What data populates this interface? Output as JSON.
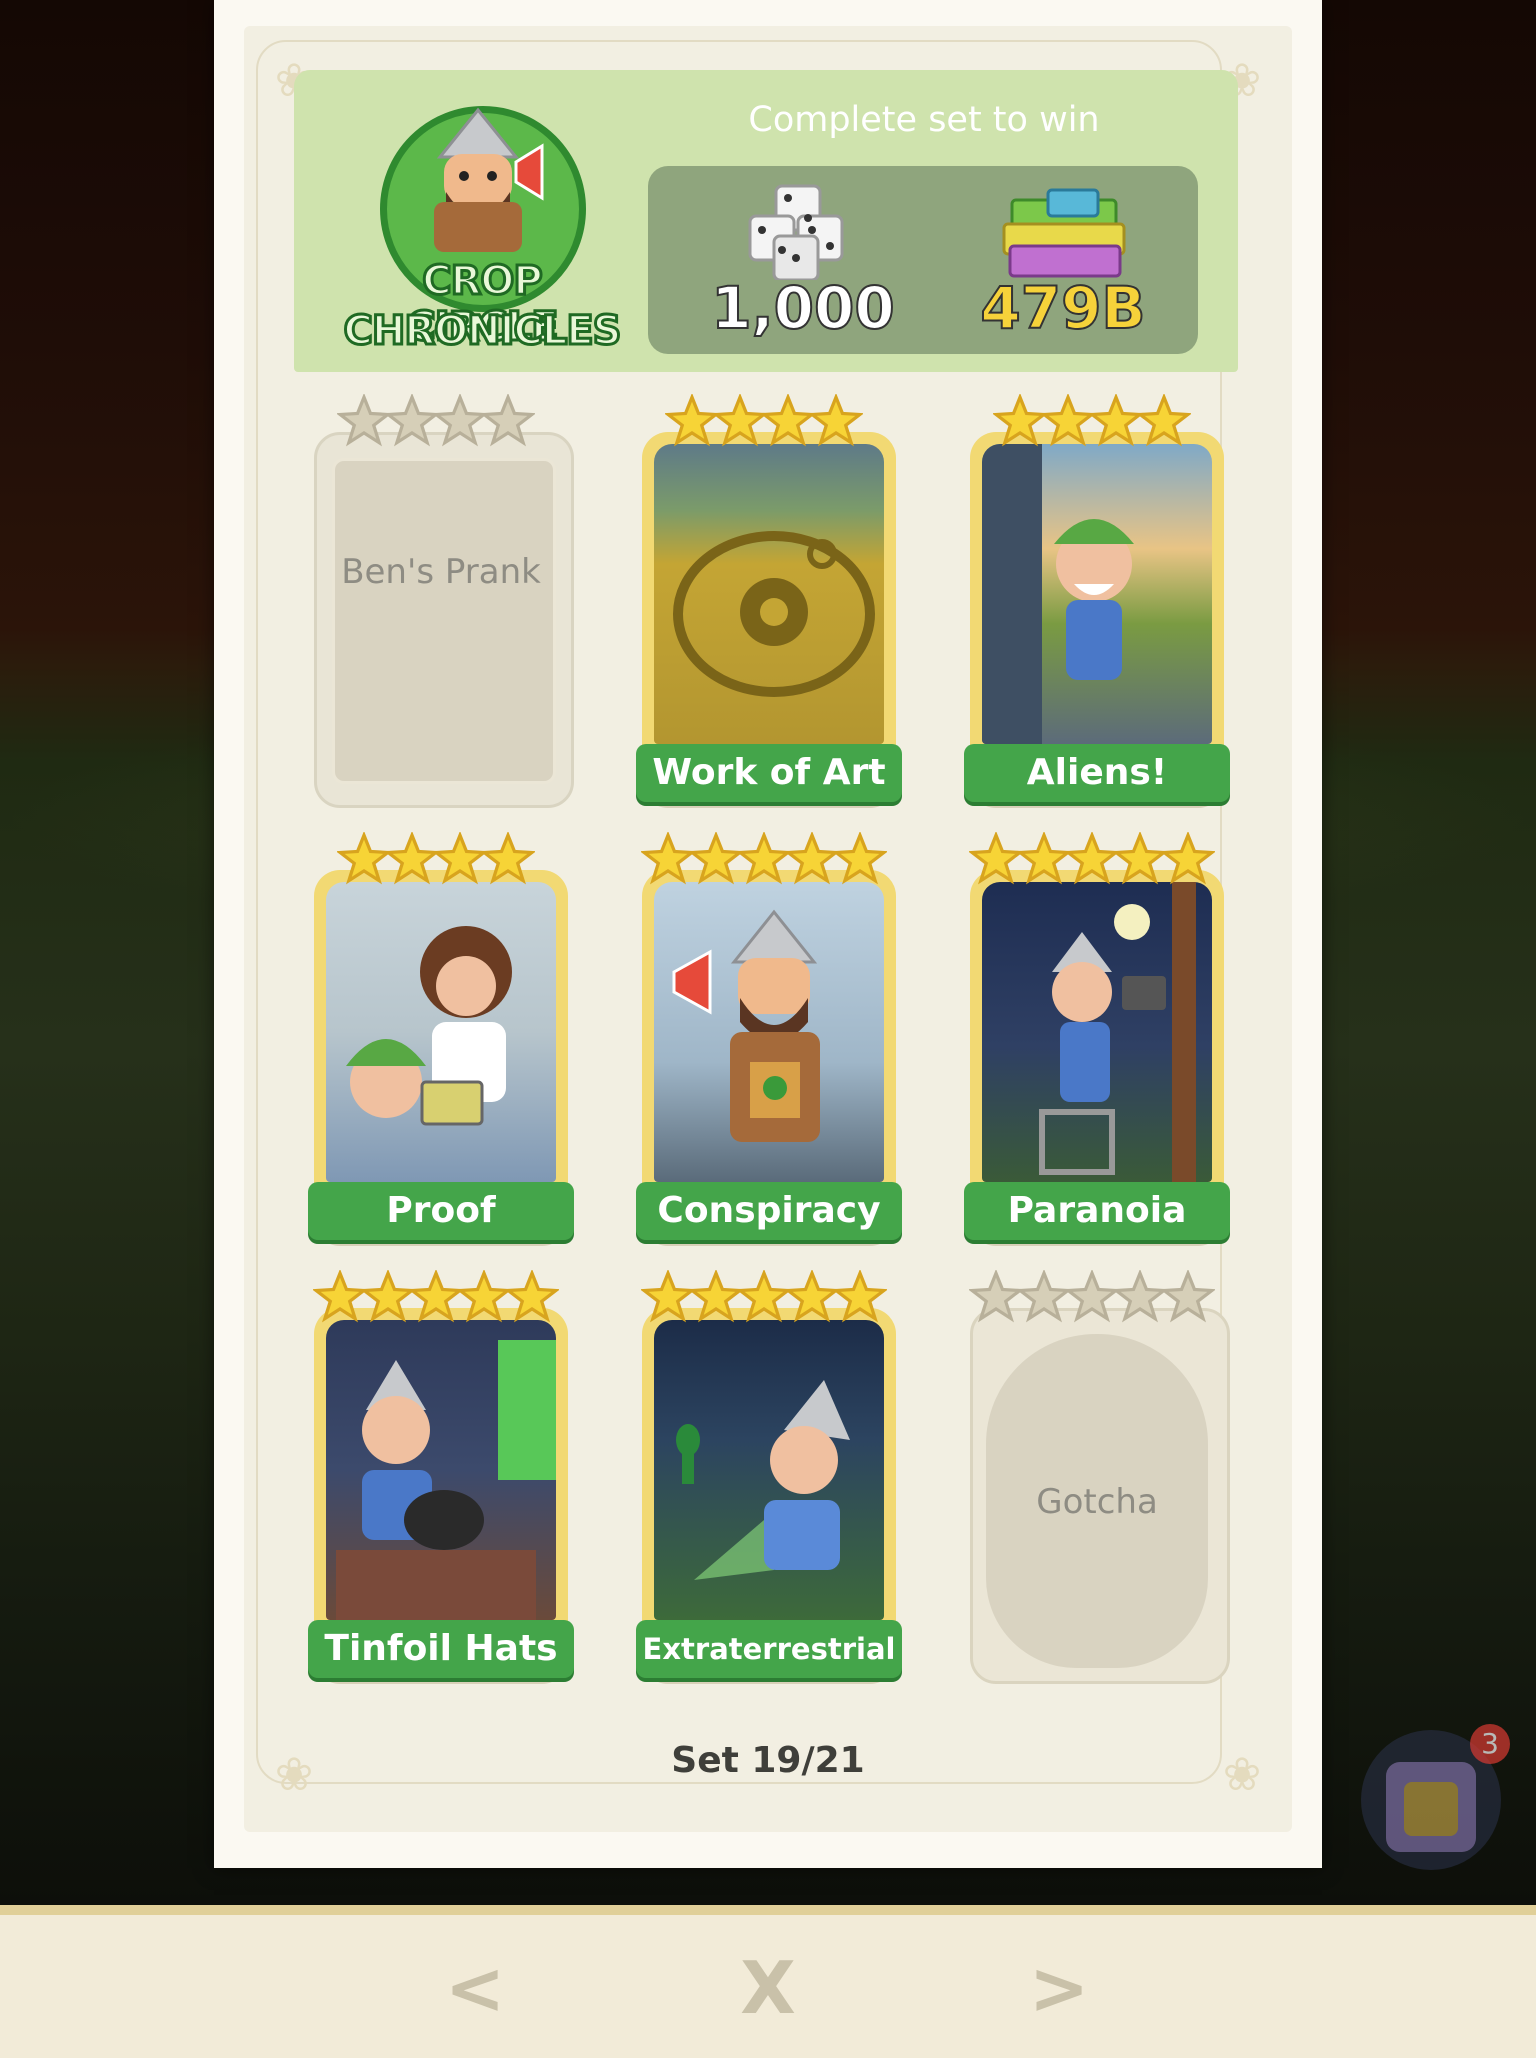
{
  "header": {
    "logo_line1": "CROP CIRCLE",
    "logo_line2": "CHRONICLES",
    "reward_title": "Complete set to win",
    "rewards": [
      {
        "icon": "dice-icon",
        "value": "1,000"
      },
      {
        "icon": "cash-stack-icon",
        "value": "479B"
      }
    ]
  },
  "cards": [
    {
      "label": "Ben's Prank",
      "stars": 4,
      "collected": false
    },
    {
      "label": "Work of Art",
      "stars": 4,
      "collected": true
    },
    {
      "label": "Aliens!",
      "stars": 4,
      "collected": true
    },
    {
      "label": "Proof",
      "stars": 4,
      "collected": true
    },
    {
      "label": "Conspiracy",
      "stars": 5,
      "collected": true
    },
    {
      "label": "Paranoia",
      "stars": 5,
      "collected": true
    },
    {
      "label": "Tinfoil Hats",
      "stars": 5,
      "collected": true
    },
    {
      "label": "Extraterrestrial",
      "stars": 5,
      "collected": true
    },
    {
      "label": "Gotcha",
      "stars": 5,
      "collected": false
    }
  ],
  "set_label": "Set 19/21",
  "nav": {
    "prev": "<",
    "close": "X",
    "next": ">"
  },
  "badge_count": "3",
  "colors": {
    "label_green": "#44a54a",
    "header_green": "#cfe3ad",
    "gold": "#f2d973"
  }
}
